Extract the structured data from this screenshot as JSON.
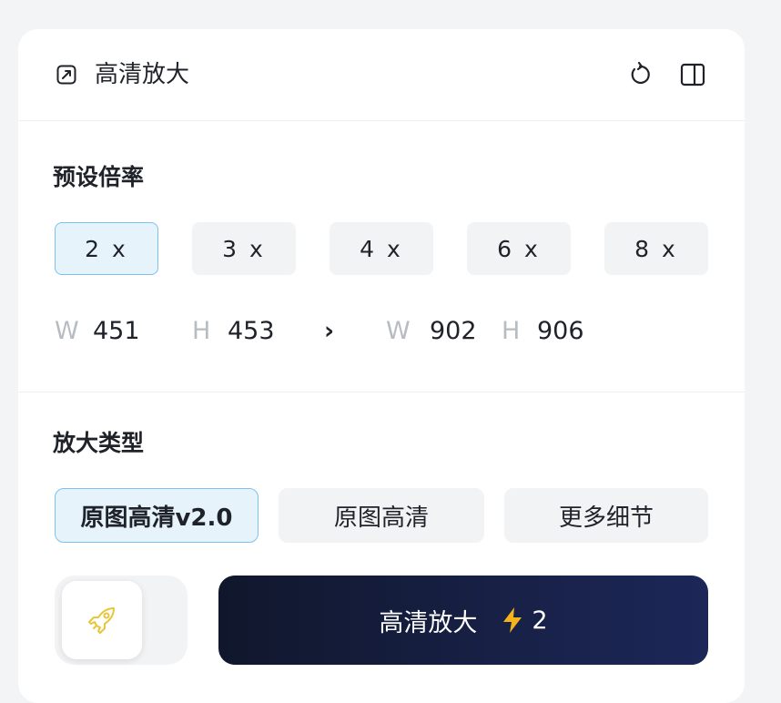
{
  "header": {
    "title": "高清放大"
  },
  "preset": {
    "title": "预设倍率",
    "options": [
      "2 x",
      "3 x",
      "4 x",
      "6 x",
      "8 x"
    ],
    "selected": "2 x"
  },
  "dimensions": {
    "w_label": "W",
    "h_label": "H",
    "source_w": "451",
    "source_h": "453",
    "arrow": "›",
    "target_w": "902",
    "target_h": "906"
  },
  "type": {
    "title": "放大类型",
    "options": [
      "原图高清v2.0",
      "原图高清",
      "更多细节"
    ],
    "selected": "原图高清v2.0"
  },
  "action": {
    "label": "高清放大",
    "cost": "2"
  },
  "colors": {
    "accent_border": "#7cc2ea",
    "accent_bg": "#e6f3fb",
    "primary_btn": "#141c3a",
    "bolt": "#f6b21b",
    "rocket": "#e8c53a"
  },
  "icons": {
    "header": "expand-square-icon",
    "reset": "rotate-ccw-icon",
    "sidebar": "panel-toggle-icon",
    "rocket": "rocket-icon",
    "cost": "lightning-bolt-icon"
  }
}
